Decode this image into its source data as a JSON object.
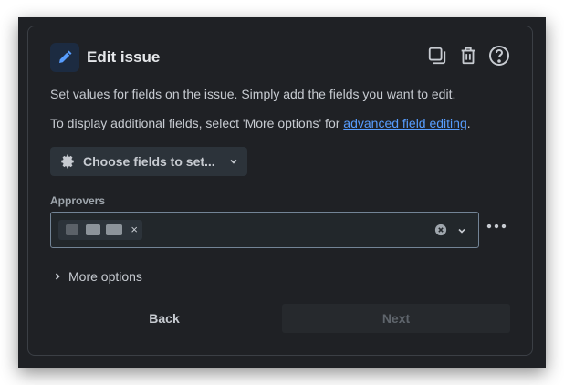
{
  "dialog": {
    "title": "Edit issue",
    "description": "Set values for fields on the issue. Simply add the fields you want to edit.",
    "additional_prefix": "To display additional fields, select 'More options' for ",
    "additional_link": "advanced field editing",
    "additional_suffix": "."
  },
  "choose_fields": {
    "label": "Choose fields to set..."
  },
  "approvers": {
    "label": "Approvers",
    "chip_remove": "×"
  },
  "more_options": {
    "label": "More options"
  },
  "actions": {
    "back": "Back",
    "next": "Next"
  },
  "icons": {
    "title": "pencil-icon",
    "header": [
      "copy-icon",
      "trash-icon",
      "help-icon"
    ],
    "choose": "gear-icon",
    "more": "ellipsis-icon"
  },
  "colors": {
    "background": "#1f2125",
    "accent": "#579dff",
    "border": "#3b3f45"
  }
}
